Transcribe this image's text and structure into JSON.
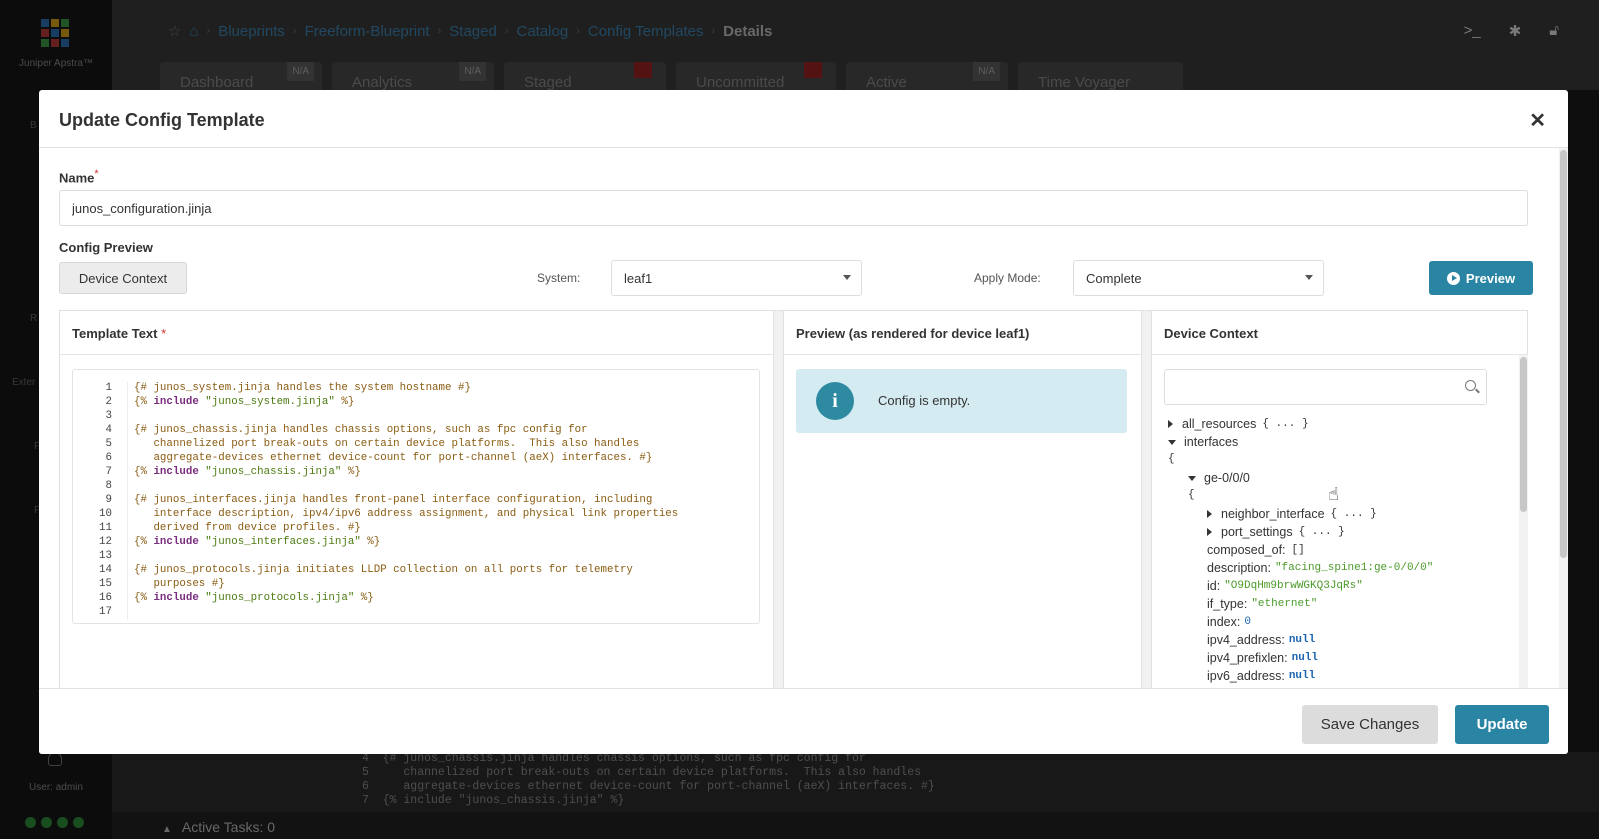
{
  "app": {
    "brand": "Juniper Apstra™",
    "side_labels": [
      "B",
      "R",
      "Exter",
      "F",
      "F"
    ],
    "user": "User: admin",
    "active_tasks": "Active Tasks: 0"
  },
  "breadcrumb": [
    "Blueprints",
    "Freeform-Blueprint",
    "Staged",
    "Catalog",
    "Config Templates",
    "Details"
  ],
  "bg_tabs": [
    {
      "label": "Dashboard",
      "flag": "N/A"
    },
    {
      "label": "Analytics",
      "flag": "N/A"
    },
    {
      "label": "Staged",
      "flag": ""
    },
    {
      "label": "Uncommitted",
      "flag": ""
    },
    {
      "label": "Active",
      "flag": "N/A"
    },
    {
      "label": "Time Voyager",
      "flag": ""
    }
  ],
  "bg_code": [
    "4  {# junos_chassis.jinja handles chassis options, such as fpc config for",
    "5     channelized port break-outs on certain device platforms.  This also handles",
    "6     aggregate-devices ethernet device-count for port-channel (aeX) interfaces. #}",
    "7  {% include \"junos_chassis.jinja\" %}"
  ],
  "modal": {
    "title": "Update Config Template",
    "name_label": "Name",
    "required_mark": "*",
    "name_value": "junos_configuration.jinja",
    "config_preview_label": "Config Preview",
    "device_context_button": "Device Context",
    "system_label": "System:",
    "system_value": "leaf1",
    "apply_mode_label": "Apply Mode:",
    "apply_mode_value": "Complete",
    "preview_button": "Preview",
    "template_text_title": "Template Text",
    "preview_title": "Preview (as rendered for device leaf1)",
    "device_context_title": "Device Context",
    "empty_message": "Config is empty.",
    "save_button": "Save Changes",
    "update_button": "Update"
  },
  "code_lines": [
    {
      "n": "1",
      "parts": [
        [
          "c",
          "{# junos_system.jinja handles the system hostname #}"
        ]
      ]
    },
    {
      "n": "2",
      "parts": [
        [
          "c",
          "{% "
        ],
        [
          "k",
          "include"
        ],
        [
          "s",
          " \"junos_system.jinja\""
        ],
        [
          "c",
          " %}"
        ]
      ]
    },
    {
      "n": "3",
      "parts": [
        [
          "c",
          ""
        ]
      ]
    },
    {
      "n": "4",
      "parts": [
        [
          "c",
          "{# junos_chassis.jinja handles chassis options, such as fpc config for"
        ]
      ]
    },
    {
      "n": "5",
      "parts": [
        [
          "c",
          "   channelized port break-outs on certain device platforms.  This also handles"
        ]
      ]
    },
    {
      "n": "6",
      "parts": [
        [
          "c",
          "   aggregate-devices ethernet device-count for port-channel (aeX) interfaces. #}"
        ]
      ]
    },
    {
      "n": "7",
      "parts": [
        [
          "c",
          "{% "
        ],
        [
          "k",
          "include"
        ],
        [
          "s",
          " \"junos_chassis.jinja\""
        ],
        [
          "c",
          " %}"
        ]
      ]
    },
    {
      "n": "8",
      "parts": [
        [
          "c",
          ""
        ]
      ]
    },
    {
      "n": "9",
      "parts": [
        [
          "c",
          "{# junos_interfaces.jinja handles front-panel interface configuration, including"
        ]
      ]
    },
    {
      "n": "10",
      "parts": [
        [
          "c",
          "   interface description, ipv4/ipv6 address assignment, and physical link properties"
        ]
      ]
    },
    {
      "n": "11",
      "parts": [
        [
          "c",
          "   derived from device profiles. #}"
        ]
      ]
    },
    {
      "n": "12",
      "parts": [
        [
          "c",
          "{% "
        ],
        [
          "k",
          "include"
        ],
        [
          "s",
          " \"junos_interfaces.jinja\""
        ],
        [
          "c",
          " %}"
        ]
      ]
    },
    {
      "n": "13",
      "parts": [
        [
          "c",
          ""
        ]
      ]
    },
    {
      "n": "14",
      "parts": [
        [
          "c",
          "{# junos_protocols.jinja initiates LLDP collection on all ports for telemetry"
        ]
      ]
    },
    {
      "n": "15",
      "parts": [
        [
          "c",
          "   purposes #}"
        ]
      ]
    },
    {
      "n": "16",
      "parts": [
        [
          "c",
          "{% "
        ],
        [
          "k",
          "include"
        ],
        [
          "s",
          " \"junos_protocols.jinja\""
        ],
        [
          "c",
          " %}"
        ]
      ]
    },
    {
      "n": "17",
      "parts": [
        [
          "c",
          ""
        ]
      ]
    }
  ],
  "tree": [
    {
      "depth": 0,
      "toggle": "closed",
      "key": "all_resources",
      "collapsed": "{ ... }"
    },
    {
      "depth": 0,
      "toggle": "open",
      "key": "interfaces"
    },
    {
      "depth": 0,
      "brace": "{"
    },
    {
      "depth": 1,
      "toggle": "open",
      "key": "ge-0/0/0"
    },
    {
      "depth": 1,
      "brace": "{"
    },
    {
      "depth": 2,
      "toggle": "closed",
      "key": "neighbor_interface",
      "collapsed": "{ ... }"
    },
    {
      "depth": 2,
      "toggle": "closed",
      "key": "port_settings",
      "collapsed": "{ ... }"
    },
    {
      "depth": 2,
      "key": "composed_of:",
      "vtype": "plain",
      "value": "[]"
    },
    {
      "depth": 2,
      "key": "description:",
      "vtype": "str",
      "value": "\"facing_spine1:ge-0/0/0\""
    },
    {
      "depth": 2,
      "key": "id:",
      "vtype": "str",
      "value": "\"O9DqHm9brwWGKQ3JqRs\""
    },
    {
      "depth": 2,
      "key": "if_type:",
      "vtype": "str",
      "value": "\"ethernet\""
    },
    {
      "depth": 2,
      "key": "index:",
      "vtype": "num",
      "value": "0"
    },
    {
      "depth": 2,
      "key": "ipv4_address:",
      "vtype": "null",
      "value": "null"
    },
    {
      "depth": 2,
      "key": "ipv4_prefixlen:",
      "vtype": "null",
      "value": "null"
    },
    {
      "depth": 2,
      "key": "ipv6_address:",
      "vtype": "null",
      "value": "null"
    }
  ],
  "colors": {
    "accent": "#2a85a5",
    "link": "#3d84b0",
    "info_bg": "#d4ecf1",
    "status_green": "#2f8a3a",
    "warn_red": "#9b2222"
  }
}
